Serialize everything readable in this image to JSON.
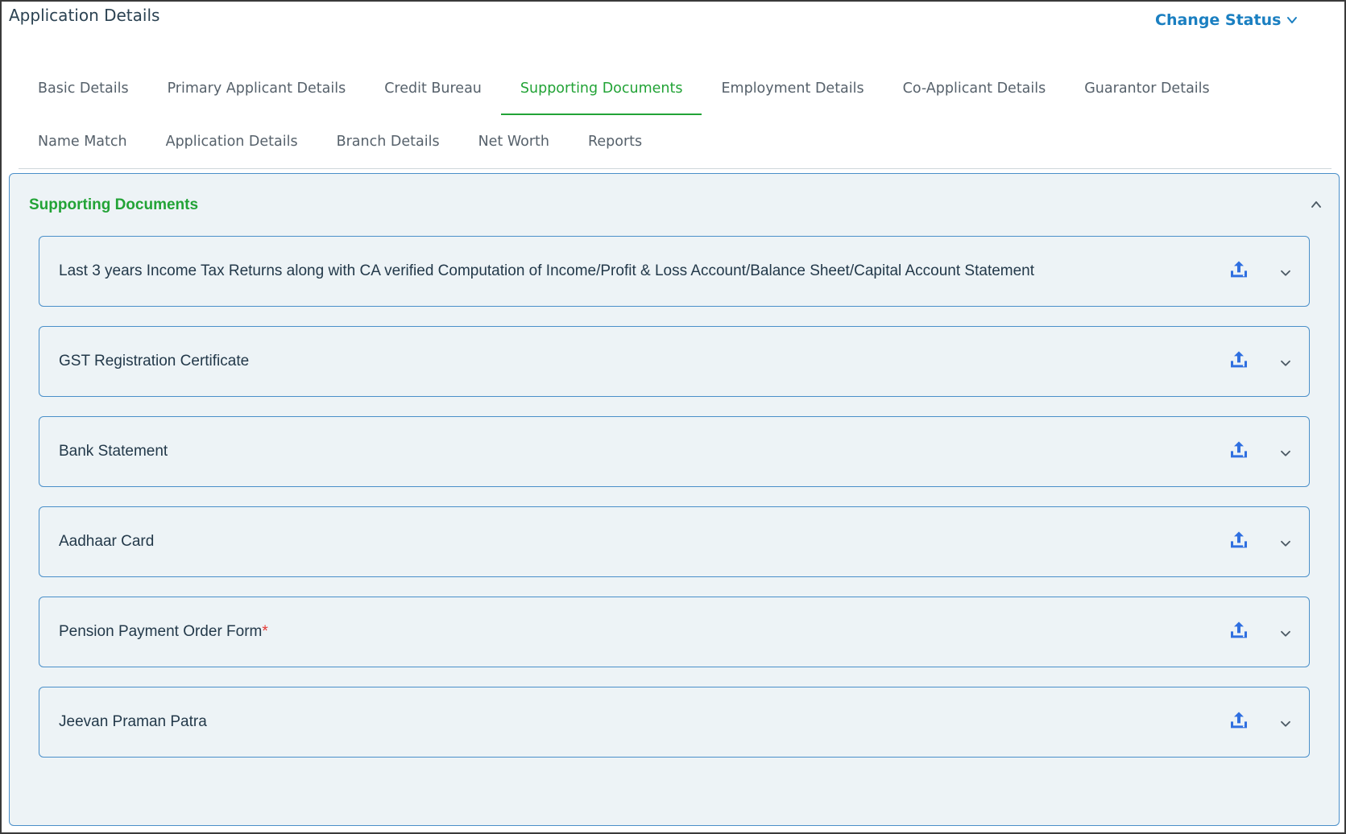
{
  "header": {
    "title": "Application Details",
    "change_status_label": "Change Status"
  },
  "tabs": {
    "row1": [
      {
        "label": "Basic Details"
      },
      {
        "label": "Primary Applicant Details"
      },
      {
        "label": "Credit Bureau"
      },
      {
        "label": "Supporting Documents",
        "active": true
      },
      {
        "label": "Employment Details"
      },
      {
        "label": "Co-Applicant Details"
      },
      {
        "label": "Guarantor Details"
      }
    ],
    "row2": [
      {
        "label": "Name Match"
      },
      {
        "label": "Application Details"
      },
      {
        "label": "Branch Details"
      },
      {
        "label": "Net Worth"
      },
      {
        "label": "Reports"
      }
    ]
  },
  "panel": {
    "title": "Supporting Documents",
    "documents": [
      {
        "label": "Last 3 years Income Tax Returns along with CA verified Computation of Income/Profit & Loss Account/Balance Sheet/Capital Account Statement",
        "required": ""
      },
      {
        "label": "GST Registration Certificate",
        "required": ""
      },
      {
        "label": "Bank Statement",
        "required": ""
      },
      {
        "label": "Aadhaar Card",
        "required": ""
      },
      {
        "label": "Pension Payment Order Form",
        "required": "*"
      },
      {
        "label": "Jeevan Praman Patra",
        "required": ""
      }
    ]
  },
  "icons": {
    "upload": "upload-icon",
    "expand": "chevron-down-icon",
    "collapse": "chevron-up-icon"
  },
  "colors": {
    "accent_green": "#22a336",
    "link_blue": "#1a7fc1",
    "upload_blue": "#2f6fe0",
    "border_blue": "#4a8fc9",
    "panel_bg": "#edf3f6",
    "required_red": "#e53935"
  }
}
